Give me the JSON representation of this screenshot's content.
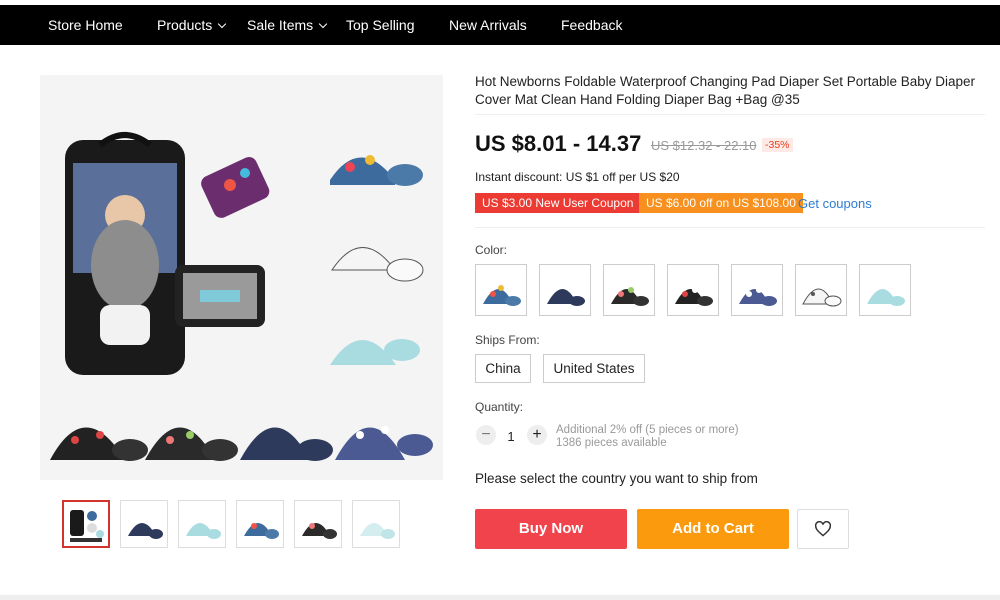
{
  "nav": {
    "items": [
      {
        "label": "Store Home",
        "dropdown": false
      },
      {
        "label": "Products",
        "dropdown": true
      },
      {
        "label": "Sale Items",
        "dropdown": true
      },
      {
        "label": "Top Selling",
        "dropdown": false
      },
      {
        "label": "New Arrivals",
        "dropdown": false
      },
      {
        "label": "Feedback",
        "dropdown": false
      }
    ]
  },
  "product": {
    "title": "Hot Newborns Foldable Waterproof Changing Pad Diaper Set Portable Baby Diaper Cover Mat Clean Hand Folding Diaper Bag +Bag @35",
    "price": "US $8.01 - 14.37",
    "old_price": "US $12.32 - 22.10",
    "discount": "-35%",
    "instant_discount": "Instant discount: US $1 off per US $20",
    "coupons": {
      "new_user": "US $3.00 New User Coupon",
      "threshold": "US $6.00 off on US $108.00",
      "get": "Get coupons"
    },
    "color_label": "Color:",
    "colors": [
      "colorful paisley",
      "navy",
      "dark floral",
      "black floral",
      "blue paisley",
      "white print",
      "light blue"
    ],
    "ships_from_label": "Ships From:",
    "ships_from": [
      "China",
      "United States"
    ],
    "quantity_label": "Quantity:",
    "quantity": "1",
    "qty_note_1": "Additional 2% off (5 pieces or more)",
    "qty_note_2": "1386 pieces available",
    "country_msg": "Please select the country you want to ship from",
    "buy_now": "Buy Now",
    "add_to_cart": "Add to Cart"
  },
  "colors": {
    "nav_bg": "#000000",
    "buy": "#f0434b",
    "cart": "#fa9a0c",
    "coupon_red": "#ec3b33",
    "coupon_orange": "#f7901e",
    "link": "#2f7bd1"
  },
  "icons": [
    "chevron-down-icon",
    "heart-icon",
    "minus-icon",
    "plus-icon"
  ]
}
